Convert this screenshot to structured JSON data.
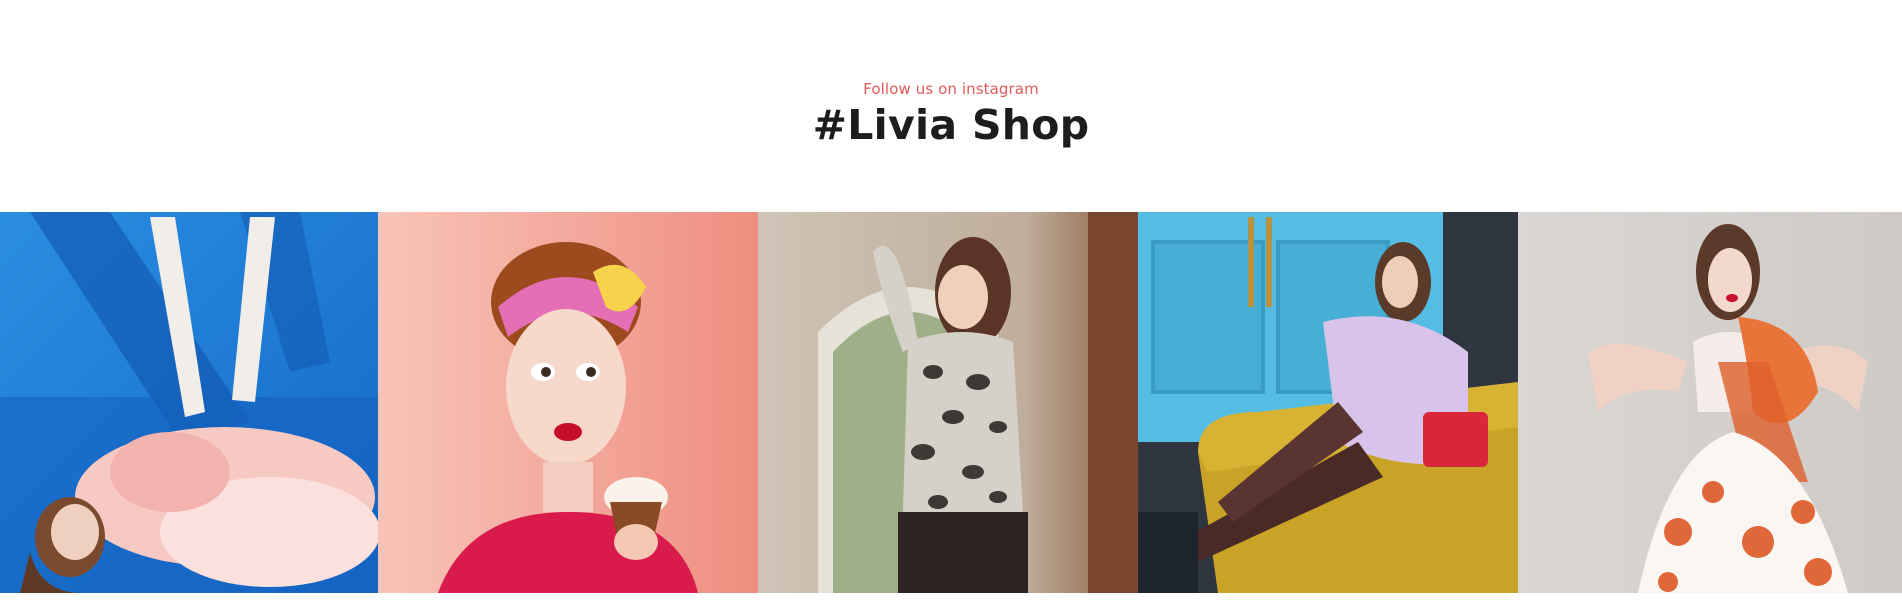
{
  "instagram": {
    "subtitle": "Follow us on instagram",
    "title": "#Livia Shop",
    "accent_color": "#e35a5a",
    "title_color": "#1d1d1d",
    "photos": [
      {
        "name": "instagram-photo-1",
        "icon": "fashion-photo",
        "background": "#1e7fd9"
      },
      {
        "name": "instagram-photo-2",
        "icon": "fashion-photo",
        "background": "#f6b3a8"
      },
      {
        "name": "instagram-photo-3",
        "icon": "fashion-photo",
        "background": "#b89a82"
      },
      {
        "name": "instagram-photo-4",
        "icon": "fashion-photo",
        "background": "#4fb6dc"
      },
      {
        "name": "instagram-photo-5",
        "icon": "fashion-photo",
        "background": "#dcd8d4"
      }
    ]
  }
}
